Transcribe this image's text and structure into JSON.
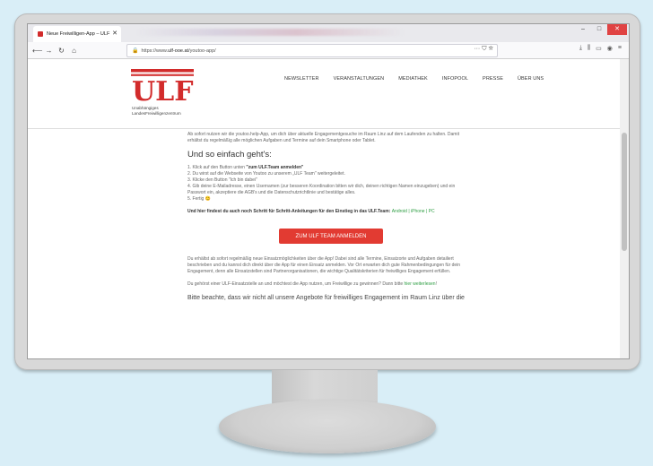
{
  "browser": {
    "tab_title": "Neue Freiwilligen-App – ULF",
    "tab_close": "✕",
    "url_prefix": "https://www.",
    "url_host": "ulf-ooe.at",
    "url_path": "/youtoo-app/",
    "url_actions": "···  ⛉  ☆",
    "window_min": "–",
    "window_max": "□",
    "window_close": "✕"
  },
  "site": {
    "logo_text": "ULF",
    "logo_sub_line1": "Unabhängiges",
    "logo_sub_line2": "LandesFreiwilligenzentrum",
    "brand_color": "#d22b2b",
    "menu": [
      "NEWSLETTER",
      "VERANSTALTUNGEN",
      "MEDIATHEK",
      "INFOPOOL",
      "PRESSE",
      "ÜBER UNS"
    ]
  },
  "content": {
    "intro": "Ab sofort nutzen wir die youtoo.help-App, um dich über aktuelle Engagementgesuche im Raum Linz auf dem Laufenden zu halten. Damit erhältst du regelmäßig alle möglichen Aufgaben und Termine auf dein Smartphone oder Tablet.",
    "heading": "Und so einfach geht's:",
    "step1_pre": "1. Klick auf den Button unten ",
    "step1_bold": "\"zum ULF.Team anmelden\"",
    "step2": "2. Du wirst auf die Webseite von Youtoo zu unserem „ULF Team\" weitergeleitet.",
    "step3": "3. Klicke den Button \"Ich bin dabei\"",
    "step4": "4. Gib deine E-Mailadresse, einen Usernamen (zur besseren Koordination bitten wir dich, deinen richtigen Namen einzugeben) und ein Passwort ein, akzeptiere die AGB's und die Datenschutzrichtlinie und bestätige alles.",
    "step5": "5. Fertig 😊",
    "guide_bold": "Und hier findest du auch noch Schritt für Schritt-Anleitungen für den Einstieg in das ULF.Team: ",
    "guide_android": "Android",
    "guide_sep": " | ",
    "guide_iphone": "iPhone",
    "guide_pc": "PC",
    "cta_label": "ZUM ULF TEAM ANMELDEN",
    "para1": "Du erhältst ab sofort regelmäßig neue Einsatzmöglichkeiten über die App! Dabei sind alle Termine, Einsatzorte und Aufgaben detailiert beschrieben und du kannst dich direkt über die App für einen Einsatz anmelden. Vor Ort erwarten dich gute Rahmenbedingungen für dein Engagement, denn alle Einsatzstellen sind Partnerorganisationen, die wichtige Qualitätskriterien für freiwilliges Engagement erfüllen.",
    "para2_pre": "Du gehörst einer ULF-Einsatzstelle an und möchtest die App nutzen, um Freiwillige zu gewinnen? Dann bitte ",
    "para2_link": "hier weiterlesen",
    "para2_post": "!",
    "para3": "Bitte beachte, dass wir nicht all unsere Angebote für freiwilliges Engagement im Raum Linz über die"
  }
}
